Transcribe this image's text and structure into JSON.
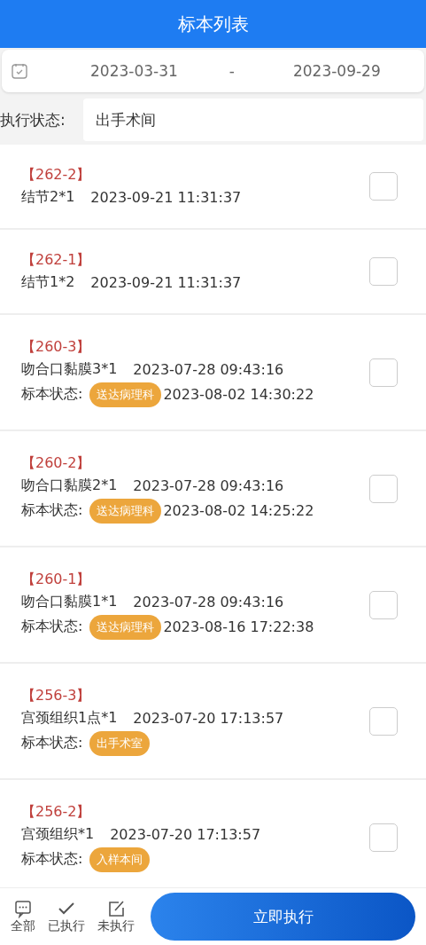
{
  "title": "标本列表",
  "date_range": {
    "start": "2023-03-31",
    "separator": "-",
    "end": "2023-09-29"
  },
  "filter": {
    "label": "执行状态:",
    "value": "出手术间"
  },
  "specimens": [
    {
      "code": "【262-2】",
      "name": "结节2*1",
      "time": "2023-09-21 11:31:37",
      "checked": false
    },
    {
      "code": "【262-1】",
      "name": "结节1*2",
      "time": "2023-09-21 11:31:37",
      "checked": false
    },
    {
      "code": "【260-3】",
      "name": "吻合口黏膜3*1",
      "time": "2023-07-28 09:43:16",
      "status_label": "标本状态:",
      "status": "送达病理科",
      "status_time": "2023-08-02 14:30:22",
      "checked": false
    },
    {
      "code": "【260-2】",
      "name": "吻合口黏膜2*1",
      "time": "2023-07-28 09:43:16",
      "status_label": "标本状态:",
      "status": "送达病理科",
      "status_time": "2023-08-02 14:25:22",
      "checked": false
    },
    {
      "code": "【260-1】",
      "name": "吻合口黏膜1*1",
      "time": "2023-07-28 09:43:16",
      "status_label": "标本状态:",
      "status": "送达病理科",
      "status_time": "2023-08-16 17:22:38",
      "checked": false
    },
    {
      "code": "【256-3】",
      "name": "宫颈组织1点*1",
      "time": "2023-07-20 17:13:57",
      "status_label": "标本状态:",
      "status": "出手术室",
      "checked": false
    },
    {
      "code": "【256-2】",
      "name": "宫颈组织*1",
      "time": "2023-07-20 17:13:57",
      "status_label": "标本状态:",
      "status": "入样本间",
      "checked": false
    }
  ],
  "bottom_tabs": [
    {
      "kind": "all",
      "label": "全部",
      "selected": false
    },
    {
      "kind": "done",
      "label": "已执行",
      "selected": false
    },
    {
      "kind": "todo",
      "label": "未执行",
      "selected": false
    }
  ],
  "action_button": "立即执行"
}
